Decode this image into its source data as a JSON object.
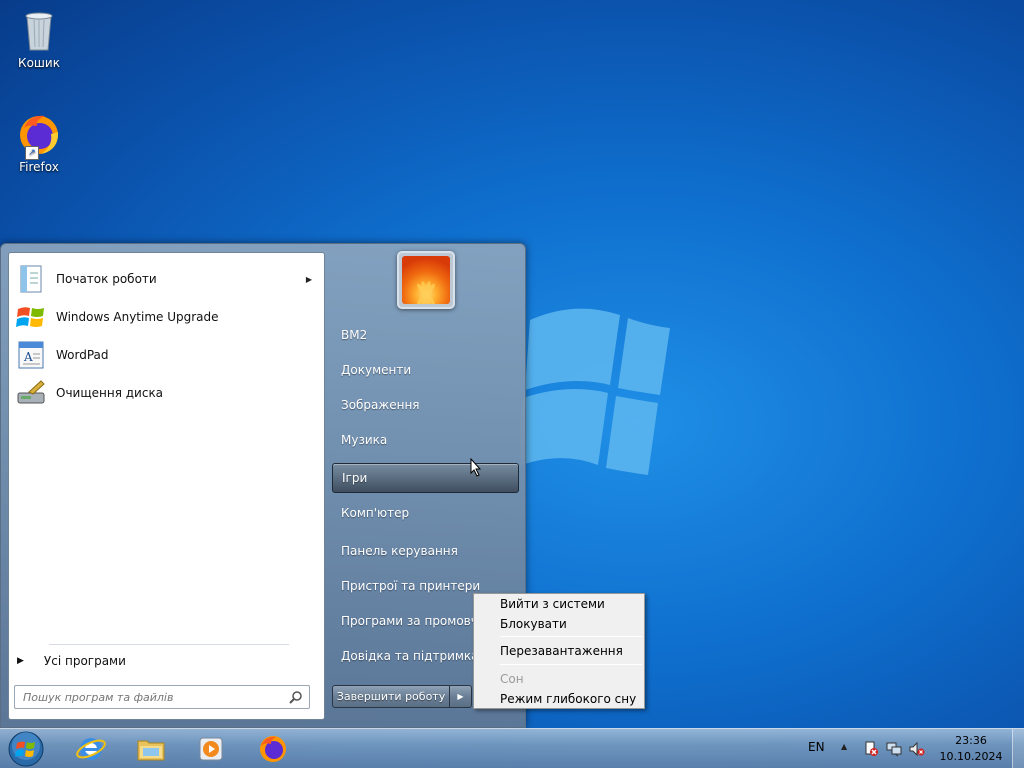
{
  "desktop": {
    "icons": [
      {
        "label": "Кошик",
        "icon": "recycle-bin-icon"
      },
      {
        "label": "Firefox",
        "icon": "firefox-icon"
      }
    ]
  },
  "start_menu": {
    "programs": [
      {
        "label": "Початок роботи",
        "icon": "getting-started-icon",
        "has_submenu": true
      },
      {
        "label": "Windows Anytime Upgrade",
        "icon": "windows-flag-icon"
      },
      {
        "label": "WordPad",
        "icon": "wordpad-icon"
      },
      {
        "label": "Очищення диска",
        "icon": "disk-cleanup-icon"
      }
    ],
    "all_programs_label": "Усі програми",
    "search_placeholder": "Пошук програм та файлів",
    "right_items": [
      {
        "label": "ВМ2"
      },
      {
        "label": "Документи"
      },
      {
        "label": "Зображення"
      },
      {
        "label": "Музика"
      },
      {
        "label": "Ігри",
        "hovered": true
      },
      {
        "label": "Комп'ютер"
      },
      {
        "label": "Панель керування"
      },
      {
        "label": "Пристрої та принтери"
      },
      {
        "label": "Програми за промовча"
      },
      {
        "label": "Довідка та підтримка"
      }
    ],
    "shutdown_label": "Завершити роботу"
  },
  "shutdown_menu": {
    "items": [
      {
        "label": "Вийти з системи",
        "enabled": true
      },
      {
        "label": "Блокувати",
        "enabled": true
      },
      {
        "label": "Перезавантаження",
        "enabled": true
      },
      {
        "label": "Сон",
        "enabled": false
      },
      {
        "label": "Режим глибокого сну",
        "enabled": true
      }
    ]
  },
  "taskbar": {
    "pinned": [
      "internet-explorer-icon",
      "windows-explorer-icon",
      "media-player-icon",
      "firefox-icon"
    ],
    "language": "EN",
    "tray_icons": [
      "action-center-icon",
      "network-icon",
      "volume-muted-icon"
    ],
    "time": "23:36",
    "date": "10.10.2024"
  },
  "colors": {
    "desktop_blue": "#0f6fce",
    "menu_glass": "#5f7896"
  }
}
